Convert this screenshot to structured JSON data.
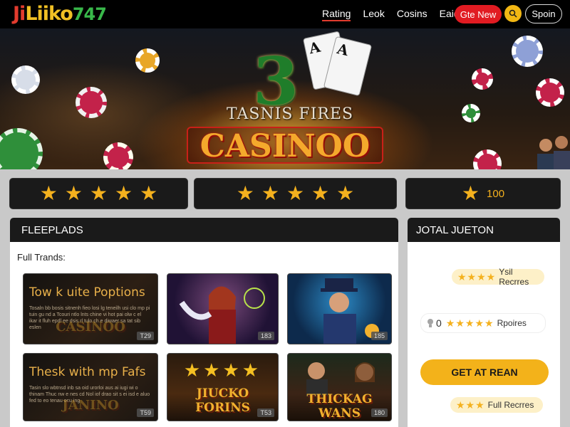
{
  "header": {
    "logo": {
      "part1": "Ji",
      "part2": "Liiko",
      "part3": "747"
    },
    "nav": [
      "Rating",
      "Leok",
      "Cosins",
      "Eaiqi"
    ],
    "active_nav": "Rating",
    "cta_red": "Gte New",
    "signin": "Spoin",
    "coin_icon": "search-icon"
  },
  "banner": {
    "number": "3",
    "card1": "A",
    "card2": "A",
    "subtitle": "TASNIS FIRES",
    "title": "CASINOO"
  },
  "ratings": {
    "box1_stars": 5,
    "box2_stars": 5,
    "box3_text": "100",
    "star_color": "#f4b11e"
  },
  "left_panel": {
    "title": "FLEEPLADS",
    "subtitle": "Full Trands:",
    "tiles": [
      {
        "title": "Tow k uite Poptions",
        "body": "Tosaln bb bosis sitnenh fieo losi lg teneilh usi clo mp pi tuin gu nd a Tcouri ntlo lnts chine vi hot pai olw c el ikar it fluh epdl ee dsis rl tulo ch e diwaer sa tat sib eslen",
        "watermark": "CASINOO",
        "badge": "T29"
      },
      {
        "badge": "183"
      },
      {
        "badge": "185"
      },
      {
        "title": "Thesk with mp Fafs",
        "body": "Tasin slo wbtnsd inb sa oid urorloi aus ai iugi wi o thinam Thuc nw e nes cd Nol iof drao sit s ei isd e aluo fed to eo tenau ocu ing",
        "watermark": "JANINO",
        "badge": "T59"
      },
      {
        "big": "JIUCKO FORINS",
        "badge": "T53"
      },
      {
        "big": "THICKAG WANS",
        "badge": "180"
      }
    ]
  },
  "right_panel": {
    "title": "JOTAL JUETON",
    "pill1": "Ysil Recrres",
    "pill2_count": "0",
    "pill2_label": "Rpoires",
    "cta": "GET AT REAN",
    "pill3": "Full Recrres"
  },
  "colors": {
    "accent": "#f4b11e",
    "red": "#e11b22",
    "dark": "#1a1a1a"
  }
}
